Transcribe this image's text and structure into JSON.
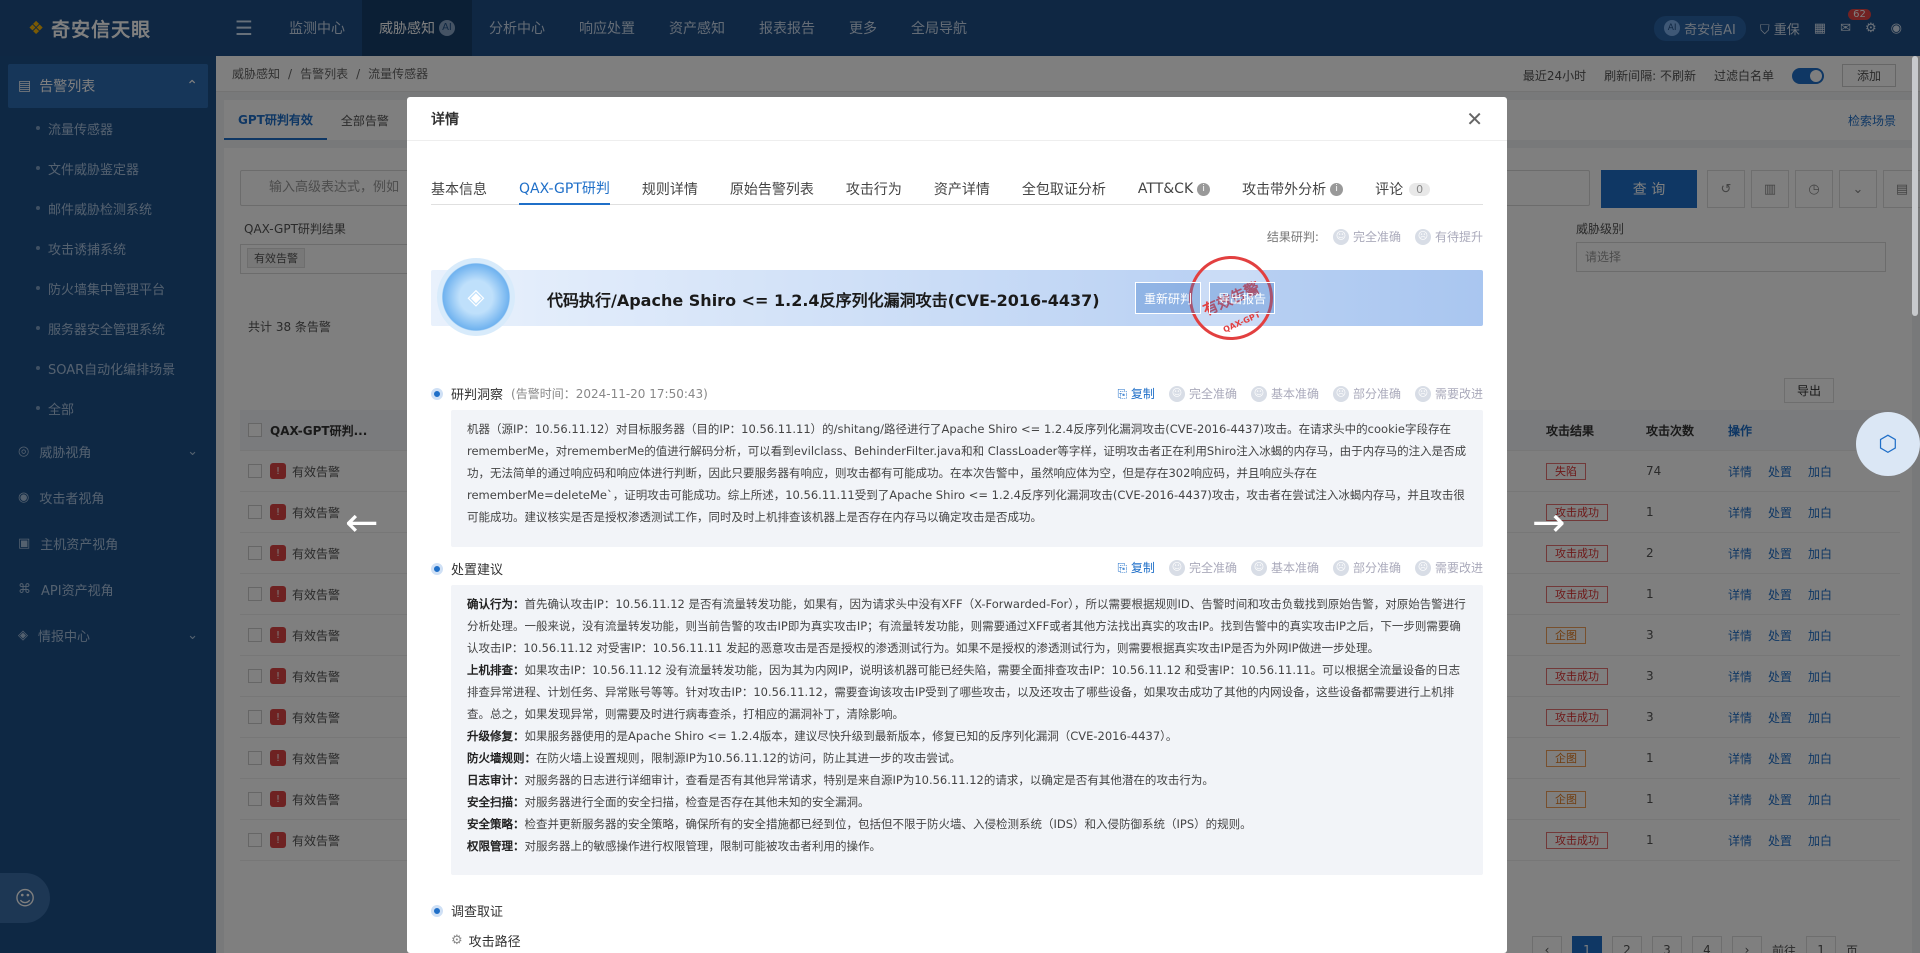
{
  "app": {
    "logo_text": "奇安信天眼"
  },
  "nav": [
    "监测中心",
    "威胁感知",
    "分析中心",
    "响应处置",
    "资产感知",
    "报表报告",
    "更多",
    "全局导航"
  ],
  "nav_active_index": 1,
  "top_right": {
    "ai_label": "奇安信AI",
    "role_label": "重保",
    "notif_count": "62"
  },
  "sidebar": {
    "head": "告警列表",
    "sub_items": [
      "流量传感器",
      "文件威胁鉴定器",
      "邮件威胁检测系统",
      "攻击诱捕系统",
      "防火墙集中管理平台",
      "服务器安全管理系统",
      "SOAR自动化编排场景",
      "全部"
    ],
    "groups": [
      "威胁视角",
      "攻击者视角",
      "主机资产视角",
      "API资产视角",
      "情报中心"
    ]
  },
  "page": {
    "breadcrumb": [
      "威胁感知",
      "告警列表",
      "流量传感器"
    ],
    "time_range": "最近24小时",
    "refresh": "刷新间隔: 不刷新",
    "whitelist": "过滤白名单",
    "add": "添加",
    "subtabs": [
      "GPT研判有效",
      "全部告警"
    ],
    "search_scene": "检索场景",
    "search_placeholder": "输入高级表达式，例如",
    "query_btn": "查 询",
    "filter_label": "QAX-GPT研判结果",
    "filter_tag": "有效告警",
    "level_label": "威胁级别",
    "level_placeholder": "请选择",
    "total": "共计 38 条告警",
    "export": "导出",
    "table_headers": [
      "QAX-GPT研判...",
      "攻击结果",
      "攻击次数",
      "操作"
    ],
    "rows": [
      {
        "name": "有效告警",
        "result": "失陷",
        "count": "74"
      },
      {
        "name": "有效告警",
        "result": "攻击成功",
        "count": "1"
      },
      {
        "name": "有效告警",
        "result": "攻击成功",
        "count": "2"
      },
      {
        "name": "有效告警",
        "result": "攻击成功",
        "count": "1"
      },
      {
        "name": "有效告警",
        "result": "企图",
        "count": "3"
      },
      {
        "name": "有效告警",
        "result": "攻击成功",
        "count": "3"
      },
      {
        "name": "有效告警",
        "result": "攻击成功",
        "count": "3"
      },
      {
        "name": "有效告警",
        "result": "企图",
        "count": "1"
      },
      {
        "name": "有效告警",
        "result": "企图",
        "count": "1"
      },
      {
        "name": "有效告警",
        "result": "攻击成功",
        "count": "1"
      }
    ],
    "row_ops": [
      "详情",
      "处置",
      "加白"
    ],
    "pages": [
      "1",
      "2",
      "3",
      "4"
    ],
    "goto": "前往",
    "goto_value": "1",
    "page_suffix": "页"
  },
  "modal": {
    "title": "详情",
    "tabs": [
      "基本信息",
      "QAX-GPT研判",
      "规则详情",
      "原始告警列表",
      "攻击行为",
      "资产详情",
      "全包取证分析",
      "ATT&CK",
      "攻击带外分析",
      "评论"
    ],
    "comment_count": "0",
    "rate_label": "结果研判:",
    "rate_opts": [
      "完全准确",
      "有待提升"
    ],
    "banner_title": "代码执行/Apache Shiro <= 1.2.4反序列化漏洞攻击(CVE-2016-4437)",
    "stamp_text": "有效告警",
    "stamp_sub": "QAX-GPT",
    "btn_rejudge": "重新研判",
    "btn_export": "导出报告",
    "sec1_title": "研判洞察",
    "sec1_time": "(告警时间：2024-11-20 17:50:43)",
    "copy": "复制",
    "feedback": [
      "完全准确",
      "基本准确",
      "部分准确",
      "需要改进"
    ],
    "sec1_text": "机器（源IP：10.56.11.12）对目标服务器（目的IP：10.56.11.11）的/shitang/路径进行了Apache Shiro <= 1.2.4反序列化漏洞攻击(CVE-2016-4437)攻击。在请求头中的cookie字段存在rememberMe，对rememberMe的值进行解码分析，可以看到evilclass、BehinderFilter.java和和 ClassLoader等字样，证明攻击者正在利用Shiro注入冰蝎的内存马，由于内存马的注入是否成功，无法简单的通过响应码和响应体进行判断，因此只要服务器有响应，则攻击都有可能成功。在本次告警中，虽然响应体为空，但是存在302响应码，并且响应头存在rememberMe=deleteMe`，证明攻击可能成功。综上所述，10.56.11.11受到了Apache Shiro <= 1.2.4反序列化漏洞攻击(CVE-2016-4437)攻击，攻击者在尝试注入冰蝎内存马，并且攻击很可能成功。建议核实是否是授权渗透测试工作，同时及时上机排查该机器上是否存在内存马以确定攻击是否成功。",
    "sec2_title": "处置建议",
    "sec2_items": [
      {
        "k": "确认行为：",
        "v": "首先确认攻击IP：10.56.11.12 是否有流量转发功能，如果有，因为请求头中没有XFF（X-Forwarded-For），所以需要根据规则ID、告警时间和攻击负载找到原始告警，对原始告警进行分析处理。一般来说，没有流量转发功能，则当前告警的攻击IP即为真实攻击IP；有流量转发功能，则需要通过XFF或者其他方法找出真实的攻击IP。找到告警中的真实攻击IP之后，下一步则需要确认攻击IP：10.56.11.12 对受害IP：10.56.11.11 发起的恶意攻击是否是授权的渗透测试行为。如果不是授权的渗透测试行为，则需要根据真实攻击IP是否为外网IP做进一步处理。"
      },
      {
        "k": "上机排查：",
        "v": "如果攻击IP：10.56.11.12 没有流量转发功能，因为其为内网IP，说明该机器可能已经失陷，需要全面排查攻击IP：10.56.11.12 和受害IP：10.56.11.11。可以根据全流量设备的日志排查异常进程、计划任务、异常账号等等。针对攻击IP：10.56.11.12，需要查询该攻击IP受到了哪些攻击，以及还攻击了哪些设备，如果攻击成功了其他的内网设备，这些设备都需要进行上机排查。总之，如果发现异常，则需要及时进行病毒查杀，打相应的漏洞补丁，清除影响。"
      },
      {
        "k": "升级修复：",
        "v": "如果服务器使用的是Apache Shiro <= 1.2.4版本，建议尽快升级到最新版本，修复已知的反序列化漏洞（CVE-2016-4437）。"
      },
      {
        "k": "防火墙规则：",
        "v": "在防火墙上设置规则，限制源IP为10.56.11.12的访问，防止其进一步的攻击尝试。"
      },
      {
        "k": "日志审计：",
        "v": "对服务器的日志进行详细审计，查看是否有其他异常请求，特别是来自源IP为10.56.11.12的请求，以确定是否有其他潜在的攻击行为。"
      },
      {
        "k": "安全扫描：",
        "v": "对服务器进行全面的安全扫描，检查是否存在其他未知的安全漏洞。"
      },
      {
        "k": "安全策略：",
        "v": "检查并更新服务器的安全策略，确保所有的安全措施都已经到位，包括但不限于防火墙、入侵检测系统（IDS）和入侵防御系统（IPS）的规则。"
      },
      {
        "k": "权限管理：",
        "v": "对服务器上的敏感操作进行权限管理，限制可能被攻击者利用的操作。"
      }
    ],
    "sec3_title": "调查取证",
    "sec3_sub": "攻击路径"
  }
}
